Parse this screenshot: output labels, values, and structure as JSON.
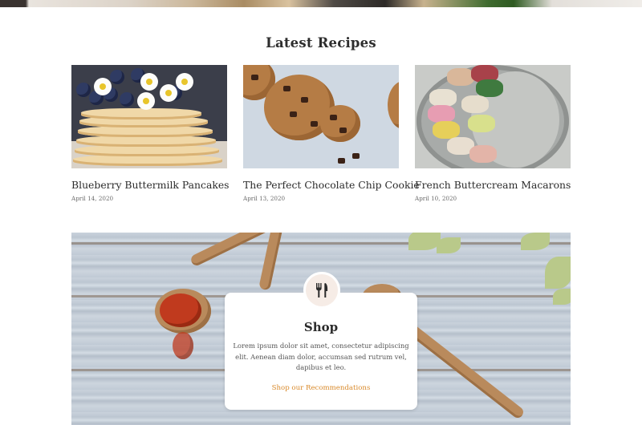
{
  "latest_recipes": {
    "heading": "Latest Recipes",
    "items": [
      {
        "title": "Blueberry Buttermilk Pancakes",
        "date": "April 14, 2020"
      },
      {
        "title": "The Perfect Chocolate Chip Cookie",
        "date": "April 13, 2020"
      },
      {
        "title": "French Buttercream Macarons",
        "date": "April 10, 2020"
      }
    ]
  },
  "shop": {
    "icon": "fork-knife-icon",
    "title": "Shop",
    "text": "Lorem ipsum dolor sit amet, consectetur adipiscing elit. Aenean diam dolor, accumsan sed rutrum vel, dapibus et leo.",
    "link_label": "Shop our Recommendations"
  },
  "colors": {
    "accent": "#d98a2b",
    "icon_bg": "#f6ece6",
    "text_dark": "#2b2b2b"
  }
}
